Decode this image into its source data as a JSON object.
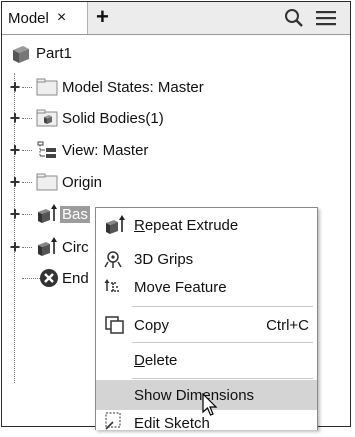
{
  "tab": {
    "title": "Model",
    "close": "×",
    "add": "+"
  },
  "toolbar": {
    "search_icon": "search-icon",
    "menu_icon": "hamburger-icon"
  },
  "tree": [
    {
      "label": "Part1",
      "icon": "part-icon",
      "expander": ""
    },
    {
      "label": "Model States: Master",
      "icon": "folder-icon",
      "expander": "+"
    },
    {
      "label": "Solid Bodies(1)",
      "icon": "solid-bodies-icon",
      "expander": "+"
    },
    {
      "label": "View: Master",
      "icon": "view-icon",
      "expander": "+"
    },
    {
      "label": "Origin",
      "icon": "folder-icon",
      "expander": "+"
    },
    {
      "label": "Bas",
      "icon": "extrude-icon",
      "expander": "+",
      "selected": true
    },
    {
      "label": "Circ",
      "icon": "extrude-icon",
      "expander": "+"
    },
    {
      "label": "End",
      "icon": "end-of-part-icon",
      "expander": ""
    }
  ],
  "context_menu": {
    "items": [
      {
        "first": "R",
        "rest": "epeat Extrude",
        "icon": "repeat-extrude-icon",
        "shortcut": ""
      },
      {
        "first": "",
        "rest": "3D Grips",
        "icon": "3d-grips-icon",
        "shortcut": ""
      },
      {
        "first": "",
        "rest": "Move Feature",
        "icon": "move-feature-icon",
        "shortcut": ""
      },
      {
        "first": "",
        "rest": "Copy",
        "icon": "copy-icon",
        "shortcut": "Ctrl+C"
      },
      {
        "first": "D",
        "rest": "elete",
        "icon": "",
        "shortcut": ""
      },
      {
        "first": "",
        "rest": "Show Dimensions",
        "icon": "",
        "shortcut": "",
        "highlighted": true
      },
      {
        "first": "",
        "rest": "Edit Sketch",
        "icon": "edit-sketch-icon",
        "shortcut": ""
      }
    ]
  },
  "colors": {
    "selection": "#9c9c9c",
    "highlight": "#d4d4d4",
    "part": "#555555"
  }
}
